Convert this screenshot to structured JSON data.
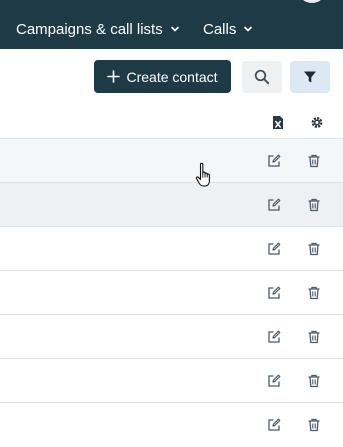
{
  "header": {
    "nav": [
      {
        "label": "Campaigns & call lists"
      },
      {
        "label": "Calls"
      }
    ]
  },
  "toolbar": {
    "create_label": "Create contact"
  },
  "icons": {
    "export": "excel-export-icon",
    "settings": "gear-icon",
    "edit": "edit-icon",
    "delete": "trash-icon",
    "search": "search-icon",
    "filter": "filter-icon"
  },
  "colors": {
    "topbar": "#1f3a47",
    "primary_button": "#1f3a47",
    "filter_active": "#dce9f5",
    "icon": "#4a5a66"
  }
}
